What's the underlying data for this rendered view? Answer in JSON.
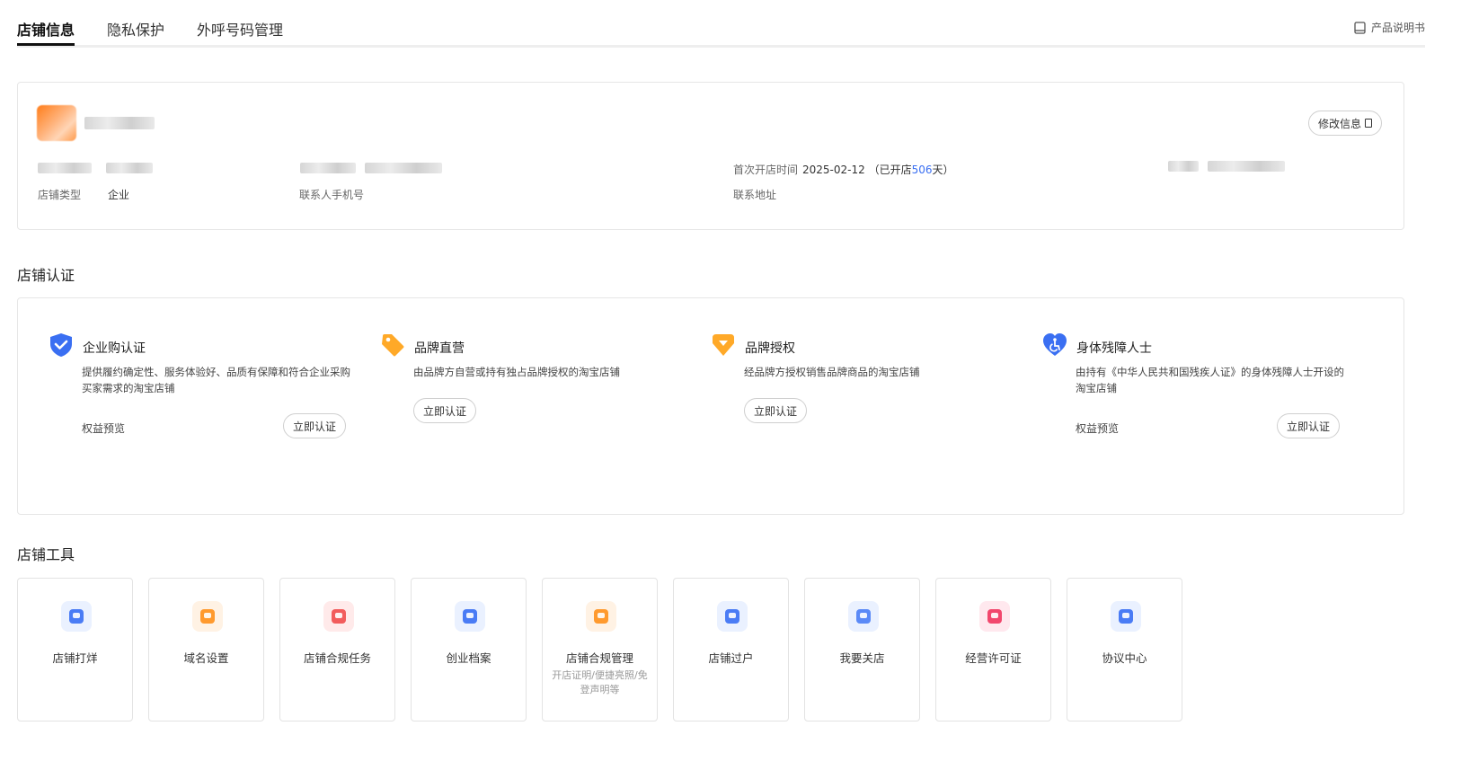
{
  "tabs": [
    {
      "label": "店铺信息",
      "active": true
    },
    {
      "label": "隐私保护",
      "active": false
    },
    {
      "label": "外呼号码管理",
      "active": false
    }
  ],
  "manual": {
    "label": "产品说明书",
    "icon": "book-icon"
  },
  "shop_info": {
    "edit_button": "修改信息",
    "fields": {
      "shop_type_label": "店铺类型",
      "shop_type_value": "企业",
      "phone_label": "联系人手机号",
      "first_open_label": "首次开店时间",
      "first_open_date": "2025-02-12",
      "open_days_prefix": "（已开店",
      "open_days": "506",
      "open_days_suffix": "天）",
      "address_label": "联系地址"
    }
  },
  "certification": {
    "title": "店铺认证",
    "items": [
      {
        "title": "企业购认证",
        "icon": "shield-check-icon",
        "desc": "提供履约确定性、服务体验好、品质有保障和符合企业采购买家需求的淘宝店铺",
        "perk": "权益预览",
        "button": "立即认证"
      },
      {
        "title": "品牌直营",
        "icon": "price-tag-icon",
        "desc": "由品牌方自营或持有独占品牌授权的淘宝店铺",
        "button": "立即认证"
      },
      {
        "title": "品牌授权",
        "icon": "diamond-badge-icon",
        "desc": "经品牌方授权销售品牌商品的淘宝店铺",
        "button": "立即认证"
      },
      {
        "title": "身体残障人士",
        "icon": "accessibility-heart-icon",
        "desc": "由持有《中华人民共和国残疾人证》的身体残障人士开设的淘宝店铺",
        "perk": "权益预览",
        "button": "立即认证"
      }
    ]
  },
  "tools": {
    "title": "店铺工具",
    "items": [
      {
        "name": "店铺打烊",
        "icon": "store-closed-icon",
        "bg": "#eaf1ff",
        "color": "#4a7cf5"
      },
      {
        "name": "域名设置",
        "icon": "domain-card-icon",
        "bg": "#fff2e4",
        "color": "#ff9a2e"
      },
      {
        "name": "店铺合规任务",
        "icon": "shield-search-icon",
        "bg": "#ffeaea",
        "color": "#f25c5c"
      },
      {
        "name": "创业档案",
        "icon": "archive-check-icon",
        "bg": "#eaf1ff",
        "color": "#4a7cf5"
      },
      {
        "name": "店铺合规管理",
        "sub": "开店证明/便捷亮照/免登声明等",
        "icon": "compliance-doc-icon",
        "bg": "#fff2e4",
        "color": "#ff9a2e"
      },
      {
        "name": "店铺过户",
        "icon": "transfer-doc-icon",
        "bg": "#eaf1ff",
        "color": "#4a7cf5"
      },
      {
        "name": "我要关店",
        "icon": "close-store-card-icon",
        "bg": "#eaf1ff",
        "color": "#5b8af7"
      },
      {
        "name": "经营许可证",
        "icon": "license-folder-icon",
        "bg": "#ffe8ee",
        "color": "#f2476d"
      },
      {
        "name": "协议中心",
        "icon": "agreement-doc-icon",
        "bg": "#eaf1ff",
        "color": "#4a7cf5"
      }
    ]
  }
}
